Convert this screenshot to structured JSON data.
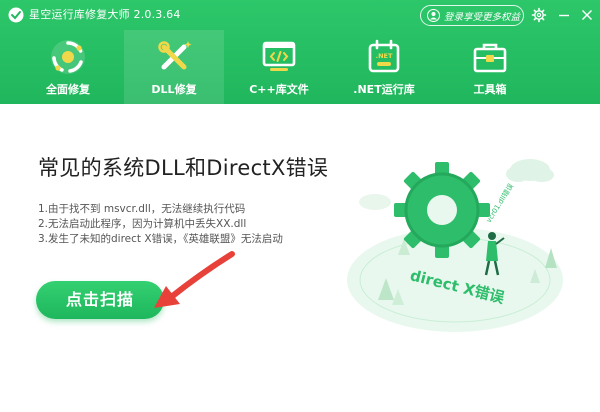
{
  "app": {
    "title": "星空运行库修复大师 2.0.3.64",
    "login_text": "登录享受更多权益"
  },
  "nav": {
    "items": [
      {
        "label": "全面修复",
        "icon": "recycle-icon"
      },
      {
        "label": "DLL修复",
        "icon": "dll-wrench-icon"
      },
      {
        "label": "C++库文件",
        "icon": "code-window-icon"
      },
      {
        "label": ".NET运行库",
        "icon": "net-calendar-icon"
      },
      {
        "label": "工具箱",
        "icon": "toolbox-icon"
      }
    ],
    "active_index": 1
  },
  "main": {
    "headline": "常见的系统DLL和DirectX错误",
    "errors": [
      "1.由于找不到 msvcr.dll，无法继续执行代码",
      "2.无法启动此程序，因为计算机中丢失XX.dll",
      "3.发生了未知的direct X错误，《英雄联盟》无法启动"
    ],
    "scan_button": "点击扫描"
  },
  "illustration": {
    "gear_text": "direct X错误",
    "dll_tag": "vcr01.dll错误"
  },
  "colors": {
    "brand_green": "#22b85f",
    "arrow_red": "#e8413a"
  }
}
